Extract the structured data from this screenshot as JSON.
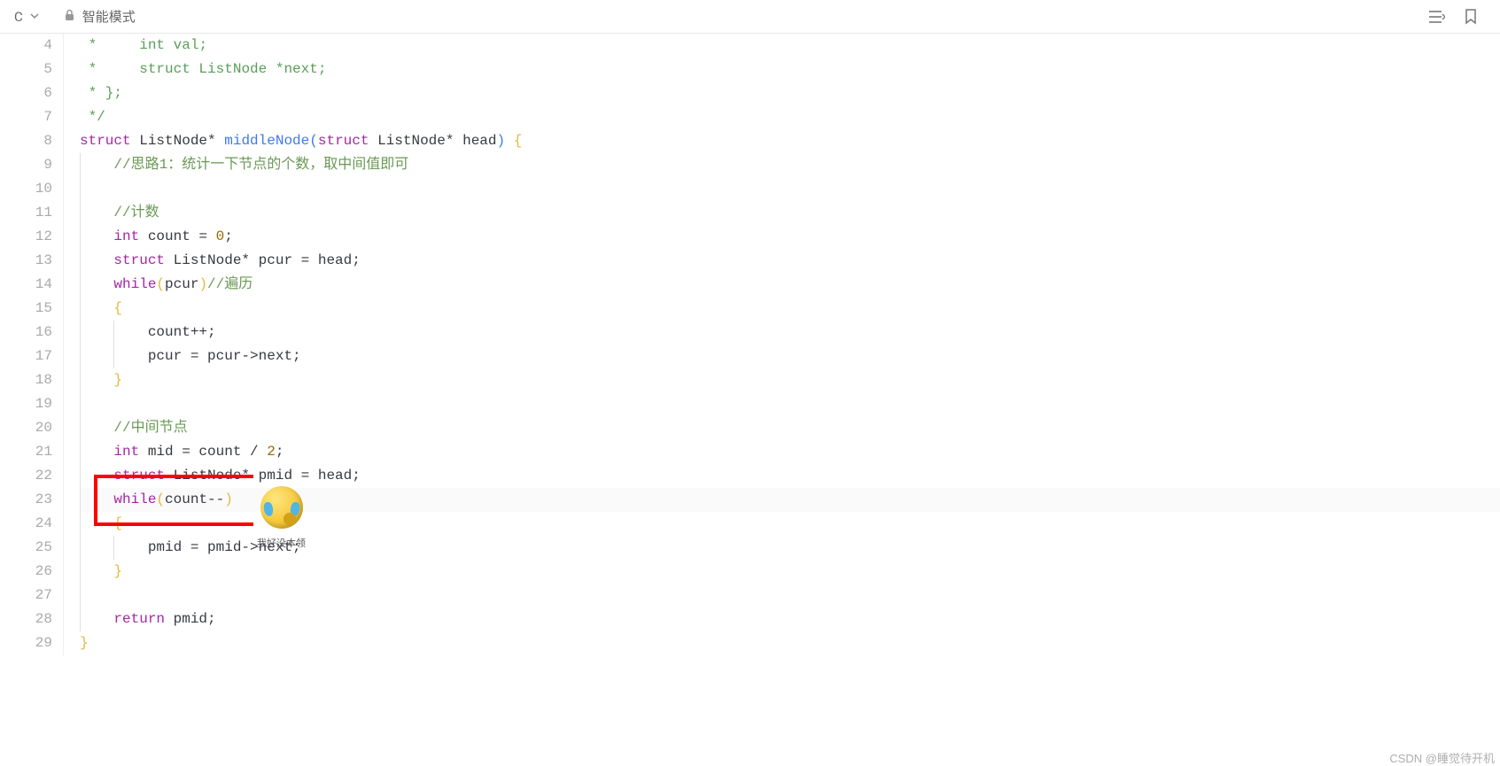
{
  "topbar": {
    "language": "C",
    "mode": "智能模式"
  },
  "gutter": {
    "start": 4,
    "end": 29
  },
  "code": {
    "l4": {
      "t1": " *     ",
      "t2": "int",
      "t3": " val;"
    },
    "l5": {
      "t1": " *     ",
      "t2": "struct",
      "t3": " ListNode *next;"
    },
    "l6": {
      "t1": " * };"
    },
    "l7": {
      "t1": " */"
    },
    "l8": {
      "t1": "struct",
      "t2": " ListNode* ",
      "t3": "middleNode",
      "t4": "(",
      "t5": "struct",
      "t6": " ListNode* head",
      "t7": ")",
      "t8": " {"
    },
    "l9": {
      "t1": "    ",
      "t2": "//思路1：统计一下节点的个数，取中间值即可"
    },
    "l10": {
      "t1": ""
    },
    "l11": {
      "t1": "    ",
      "t2": "//计数"
    },
    "l12": {
      "t1": "    ",
      "t2": "int",
      "t3": " count = ",
      "t4": "0",
      "t5": ";"
    },
    "l13": {
      "t1": "    ",
      "t2": "struct",
      "t3": " ListNode* pcur = head;"
    },
    "l14": {
      "t1": "    ",
      "t2": "while",
      "t3": "(",
      "t4": "pcur",
      "t5": ")",
      "t6": "//遍历"
    },
    "l15": {
      "t1": "    {"
    },
    "l16": {
      "t1": "        count++;"
    },
    "l17": {
      "t1": "        pcur = pcur->next;"
    },
    "l18": {
      "t1": "    }"
    },
    "l19": {
      "t1": ""
    },
    "l20": {
      "t1": "    ",
      "t2": "//中间节点"
    },
    "l21": {
      "t1": "    ",
      "t2": "int",
      "t3": " mid = count / ",
      "t4": "2",
      "t5": ";"
    },
    "l22": {
      "t1": "    ",
      "t2": "struct",
      "t3": " ListNode* pmid = head;"
    },
    "l23": {
      "t1": "    ",
      "t2": "while",
      "t3": "(",
      "t4": "count--",
      "t5": ")"
    },
    "l24": {
      "t1": "    {"
    },
    "l25": {
      "t1": "        pmid = pmid->next;"
    },
    "l26": {
      "t1": "    }"
    },
    "l27": {
      "t1": ""
    },
    "l28": {
      "t1": "    ",
      "t2": "return",
      "t3": " pmid;"
    },
    "l29": {
      "t1": "}"
    }
  },
  "overlay": {
    "emoji_caption": "我好没本领"
  },
  "watermark": "CSDN @睡觉待开机"
}
